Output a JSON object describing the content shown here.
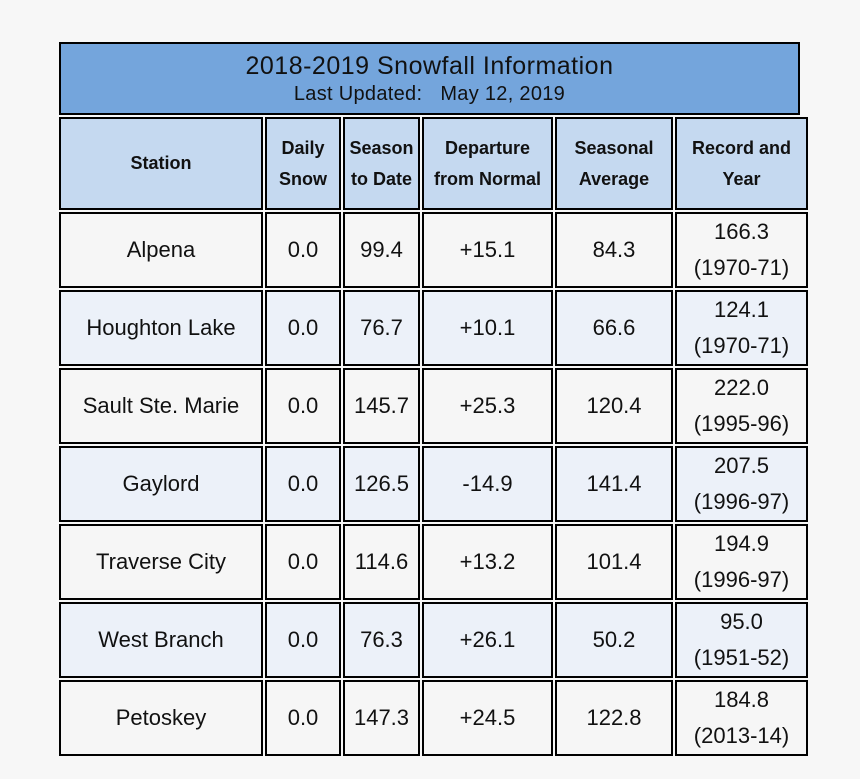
{
  "title": {
    "main": "2018-2019 Snowfall Information",
    "updated_label": "Last Updated:",
    "updated_date": "May 12, 2019"
  },
  "columns": [
    {
      "line1": "Station",
      "line2": ""
    },
    {
      "line1": "Daily",
      "line2": "Snow"
    },
    {
      "line1": "Season",
      "line2": "to Date"
    },
    {
      "line1": "Departure",
      "line2": "from Normal"
    },
    {
      "line1": "Seasonal",
      "line2": "Average"
    },
    {
      "line1": "Record and",
      "line2": "Year"
    }
  ],
  "colors": {
    "title_bg": "#74a5dc",
    "header_bg": "#c5d9f0",
    "row_odd_bg": "#f6f6f6",
    "row_even_bg": "#ecf1f9",
    "negative_text": "#e8141b"
  },
  "rows": [
    {
      "station": "Alpena",
      "daily": "0.0",
      "season": "99.4",
      "departure": "+15.1",
      "average": "84.3",
      "record": "166.3",
      "record_year": "(1970-71)"
    },
    {
      "station": "Houghton Lake",
      "daily": "0.0",
      "season": "76.7",
      "departure": "+10.1",
      "average": "66.6",
      "record": "124.1",
      "record_year": "(1970-71)"
    },
    {
      "station": "Sault Ste. Marie",
      "daily": "0.0",
      "season": "145.7",
      "departure": "+25.3",
      "average": "120.4",
      "record": "222.0",
      "record_year": "(1995-96)"
    },
    {
      "station": "Gaylord",
      "daily": "0.0",
      "season": "126.5",
      "departure": "-14.9",
      "average": "141.4",
      "record": "207.5",
      "record_year": "(1996-97)"
    },
    {
      "station": "Traverse City",
      "daily": "0.0",
      "season": "114.6",
      "departure": "+13.2",
      "average": "101.4",
      "record": "194.9",
      "record_year": "(1996-97)"
    },
    {
      "station": "West Branch",
      "daily": "0.0",
      "season": "76.3",
      "departure": "+26.1",
      "average": "50.2",
      "record": "95.0",
      "record_year": "(1951-52)"
    },
    {
      "station": "Petoskey",
      "daily": "0.0",
      "season": "147.3",
      "departure": "+24.5",
      "average": "122.8",
      "record": "184.8",
      "record_year": "(2013-14)"
    }
  ]
}
